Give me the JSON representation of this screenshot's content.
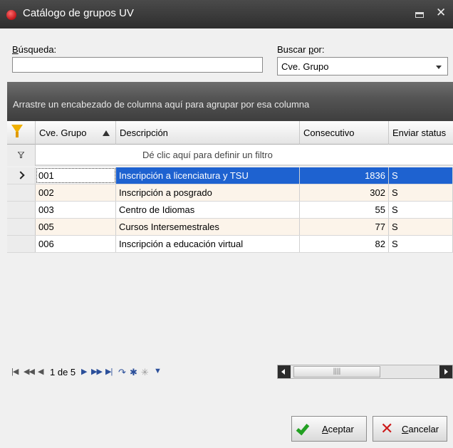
{
  "window": {
    "title": "Catálogo de grupos UV"
  },
  "search": {
    "label_hotkey": "B",
    "label_rest": "úsqueda:",
    "value": "",
    "placeholder": ""
  },
  "search_by": {
    "label_pre": "Buscar ",
    "label_hotkey": "p",
    "label_post": "or:",
    "selected": "Cve. Grupo"
  },
  "group_panel": {
    "text": "Arrastre un encabezado de columna aquí para agrupar por esa columna"
  },
  "grid": {
    "columns": [
      "Cve. Grupo",
      "Descripción",
      "Consecutivo",
      "Enviar status"
    ],
    "filter_prompt": "Dé clic aquí para definir un filtro",
    "rows": [
      {
        "cve": "001",
        "desc": "Inscripción a licenciatura y TSU",
        "cons": "1836",
        "env": "S"
      },
      {
        "cve": "002",
        "desc": "Inscripción a posgrado",
        "cons": "302",
        "env": "S"
      },
      {
        "cve": "003",
        "desc": "Centro de Idiomas",
        "cons": "55",
        "env": "S"
      },
      {
        "cve": "005",
        "desc": "Cursos Intersemestrales",
        "cons": "77",
        "env": "S"
      },
      {
        "cve": "006",
        "desc": "Inscripción a educación virtual",
        "cons": "82",
        "env": "S"
      }
    ],
    "selected_row": 0
  },
  "navigator": {
    "page_text": "1 de 5"
  },
  "buttons": {
    "accept_hotkey": "A",
    "accept_rest": "ceptar",
    "cancel_hotkey": "C",
    "cancel_rest": "ancelar"
  },
  "colors": {
    "selection": "#1e62d0",
    "alt_row": "#fcf4ea",
    "titlebar": "#3a3a3a"
  }
}
